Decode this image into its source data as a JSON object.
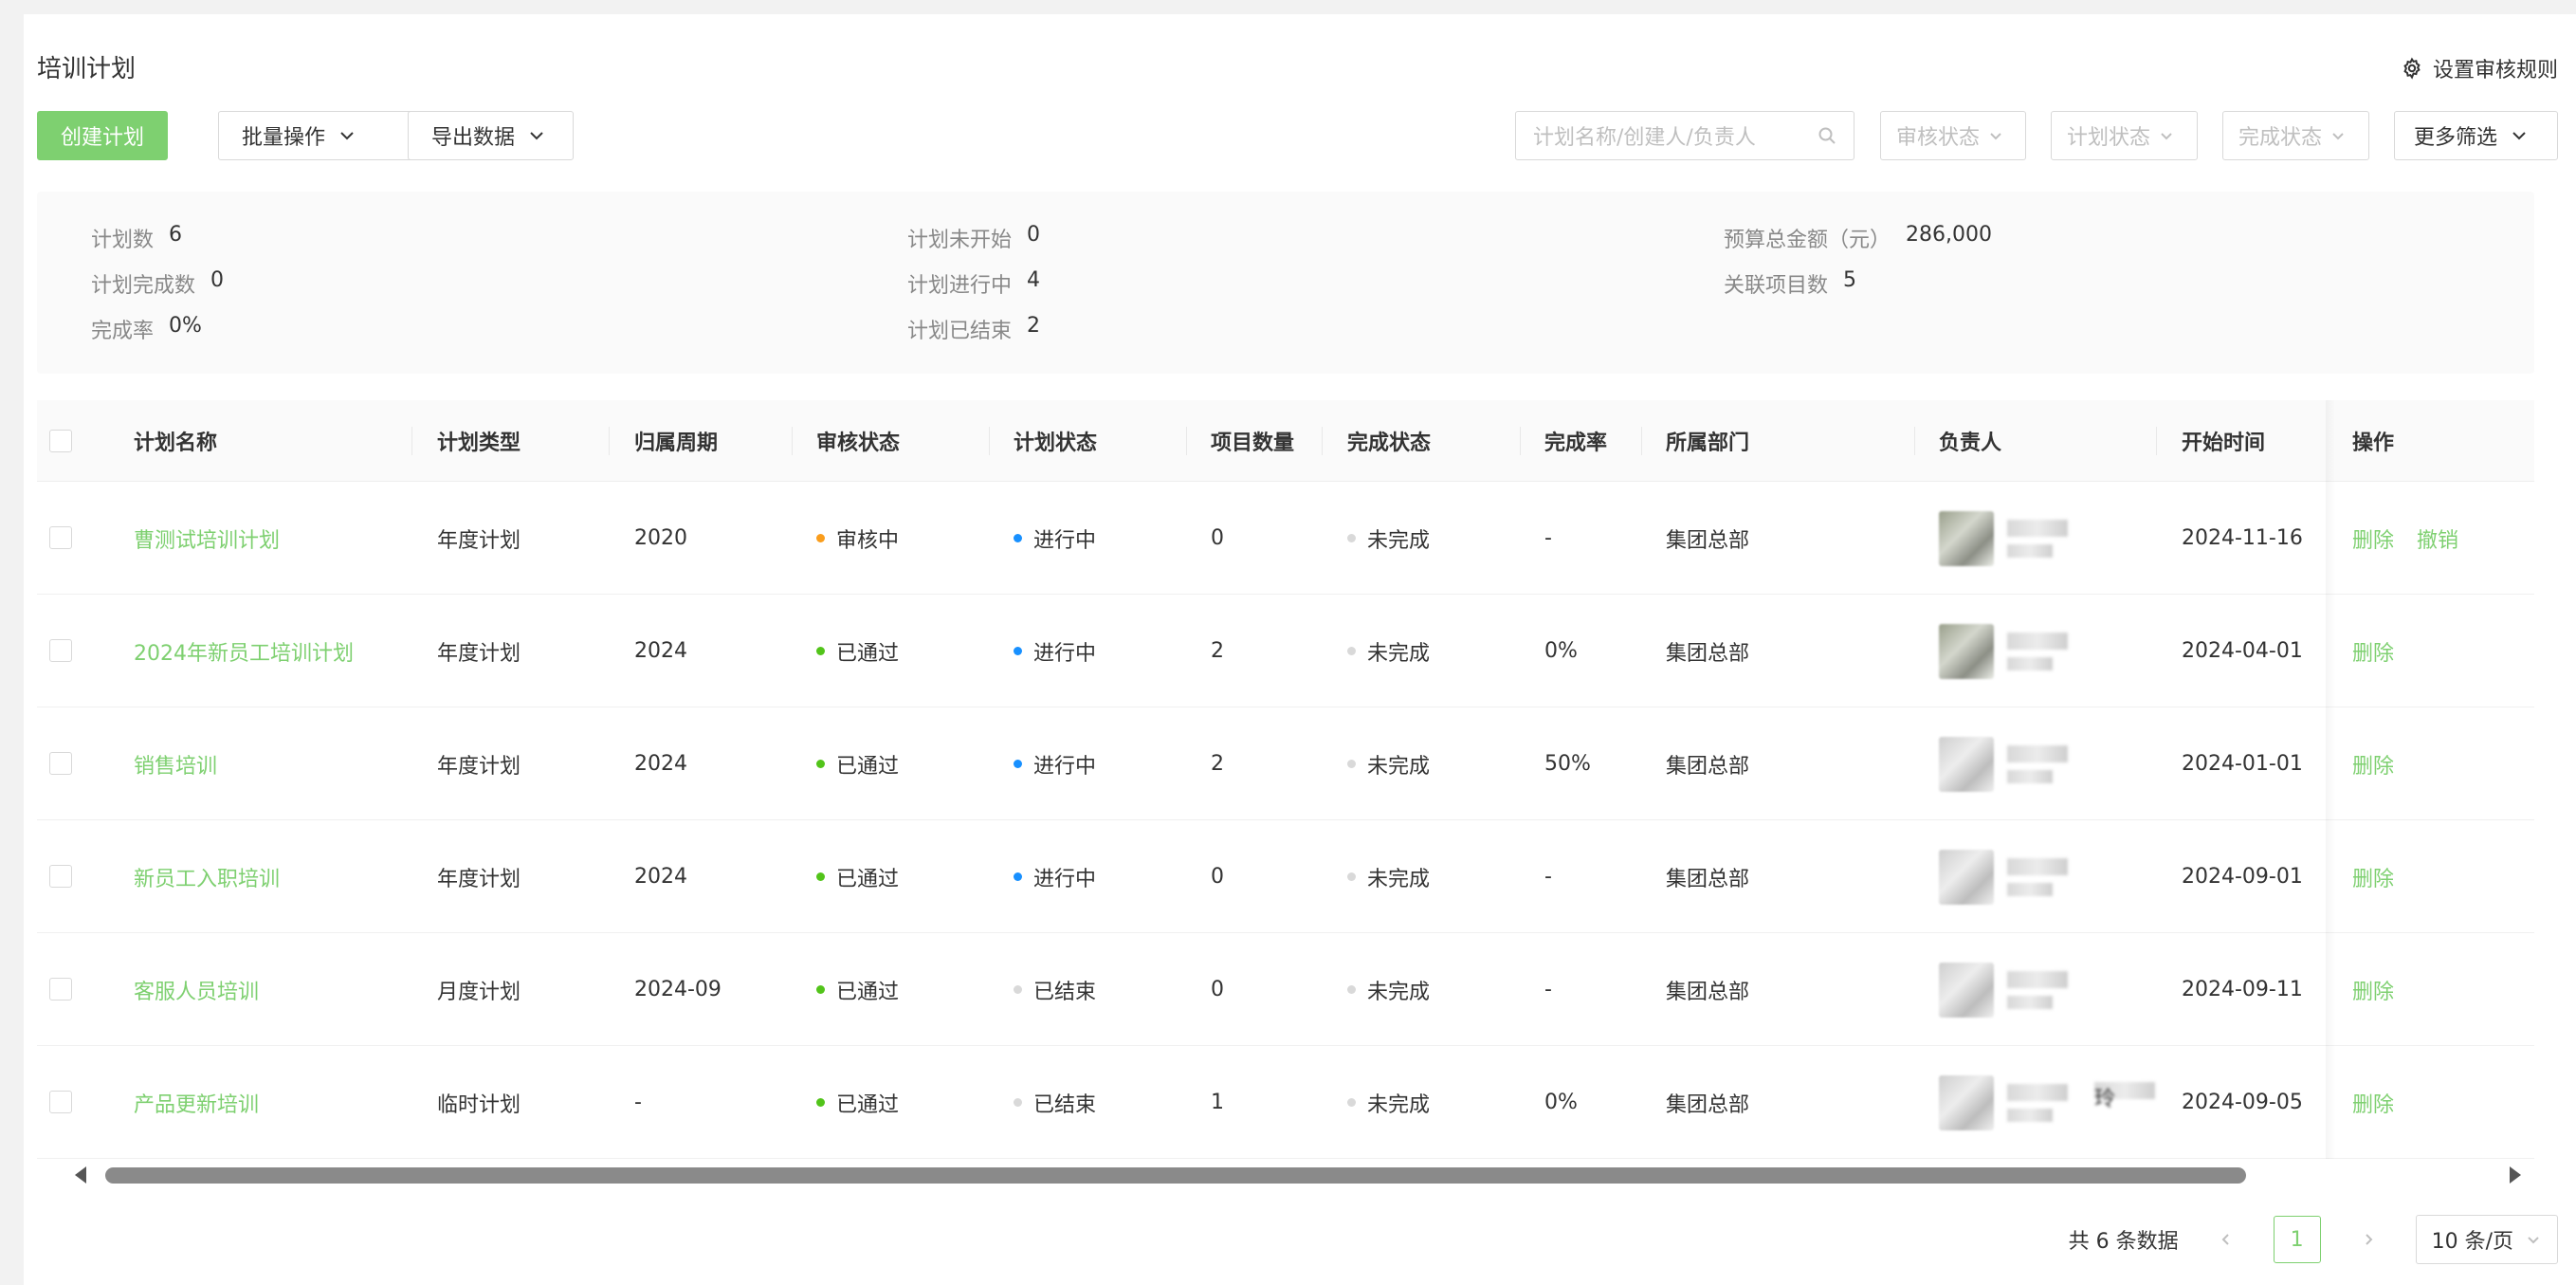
{
  "header": {
    "title": "培训计划",
    "settings_label": "设置审核规则"
  },
  "toolbar": {
    "create_label": "创建计划",
    "batch_label": "批量操作",
    "export_label": "导出数据",
    "search_placeholder": "计划名称/创建人/负责人",
    "filter_audit": "审核状态",
    "filter_plan": "计划状态",
    "filter_complete": "完成状态",
    "more_filter": "更多筛选"
  },
  "stats": {
    "plan_count_label": "计划数",
    "plan_count": "6",
    "plan_done_label": "计划完成数",
    "plan_done": "0",
    "rate_label": "完成率",
    "rate": "0%",
    "not_started_label": "计划未开始",
    "not_started": "0",
    "in_progress_label": "计划进行中",
    "in_progress": "4",
    "ended_label": "计划已结束",
    "ended": "2",
    "budget_label": "预算总金额（元）",
    "budget": "286,000",
    "projects_label": "关联项目数",
    "projects": "5"
  },
  "table": {
    "columns": [
      "计划名称",
      "计划类型",
      "归属周期",
      "审核状态",
      "计划状态",
      "项目数量",
      "完成状态",
      "完成率",
      "所属部门",
      "负责人",
      "开始时间",
      "操作"
    ],
    "rows": [
      {
        "name": "曹测试培训计划",
        "type": "年度计划",
        "period": "2020",
        "audit": "审核中",
        "audit_color": "#fa9d1c",
        "plan": "进行中",
        "plan_color": "#1890ff",
        "count": "0",
        "complete": "未完成",
        "rate": "-",
        "dept": "集团总部",
        "owner_tail": "",
        "start": "2024-11-16",
        "ops": [
          "删除",
          "撤销"
        ]
      },
      {
        "name": "2024年新员工培训计划",
        "type": "年度计划",
        "period": "2024",
        "audit": "已通过",
        "audit_color": "#52c41a",
        "plan": "进行中",
        "plan_color": "#1890ff",
        "count": "2",
        "complete": "未完成",
        "rate": "0%",
        "dept": "集团总部",
        "owner_tail": "",
        "start": "2024-04-01",
        "ops": [
          "删除"
        ]
      },
      {
        "name": "销售培训",
        "type": "年度计划",
        "period": "2024",
        "audit": "已通过",
        "audit_color": "#52c41a",
        "plan": "进行中",
        "plan_color": "#1890ff",
        "count": "2",
        "complete": "未完成",
        "rate": "50%",
        "dept": "集团总部",
        "owner_tail": "",
        "start": "2024-01-01",
        "ops": [
          "删除"
        ]
      },
      {
        "name": "新员工入职培训",
        "type": "年度计划",
        "period": "2024",
        "audit": "已通过",
        "audit_color": "#52c41a",
        "plan": "进行中",
        "plan_color": "#1890ff",
        "count": "0",
        "complete": "未完成",
        "rate": "-",
        "dept": "集团总部",
        "owner_tail": "",
        "start": "2024-09-01",
        "ops": [
          "删除"
        ]
      },
      {
        "name": "客服人员培训",
        "type": "月度计划",
        "period": "2024-09",
        "audit": "已通过",
        "audit_color": "#52c41a",
        "plan": "已结束",
        "plan_color": "#d9d9d9",
        "count": "0",
        "complete": "未完成",
        "rate": "-",
        "dept": "集团总部",
        "owner_tail": "",
        "start": "2024-09-11",
        "ops": [
          "删除"
        ]
      },
      {
        "name": "产品更新培训",
        "type": "临时计划",
        "period": "-",
        "audit": "已通过",
        "audit_color": "#52c41a",
        "plan": "已结束",
        "plan_color": "#d9d9d9",
        "count": "1",
        "complete": "未完成",
        "rate": "0%",
        "dept": "集团总部",
        "owner_tail": "玲",
        "start": "2024-09-05",
        "ops": [
          "删除"
        ]
      }
    ]
  },
  "pager": {
    "total": "共 6 条数据",
    "current": "1",
    "page_size": "10 条/页"
  },
  "colors": {
    "accent": "#7ed070",
    "in_review": "#fa9d1c",
    "approved": "#52c41a",
    "in_progress": "#1890ff",
    "ended": "#d9d9d9"
  }
}
